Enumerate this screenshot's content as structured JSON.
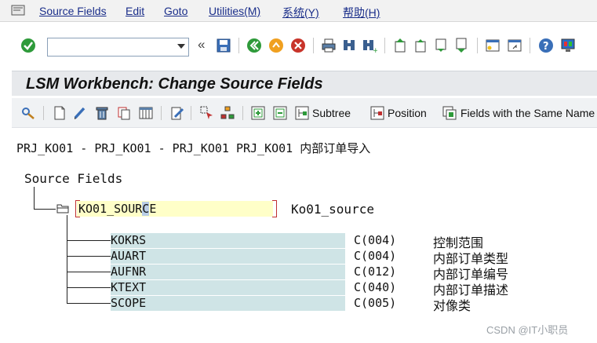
{
  "menu": {
    "items": [
      "Source Fields",
      "Edit",
      "Goto",
      "Utilities(M)",
      "系统(Y)",
      "帮助(H)"
    ]
  },
  "command_field": {
    "value": ""
  },
  "toolbar": {
    "nav_back_symbol": "«"
  },
  "title": "LSM Workbench: Change Source Fields",
  "app_toolbar": {
    "subtree_label": "Subtree",
    "position_label": "Position",
    "same_name_label": "Fields with the Same Name"
  },
  "content": {
    "headline": "PRJ_KO01 - PRJ_KO01 - PRJ_KO01 PRJ_KO01 内部订单导入",
    "root_label": "Source Fields",
    "structure": {
      "name_pre": "KO01_SOUR",
      "name_cursor": "C",
      "name_post": "E",
      "description": "Ko01_source"
    },
    "fields": [
      {
        "name": "KOKRS",
        "type": "C(004)",
        "desc": "控制范围"
      },
      {
        "name": "AUART",
        "type": "C(004)",
        "desc": "内部订单类型"
      },
      {
        "name": "AUFNR",
        "type": "C(012)",
        "desc": "内部订单编号"
      },
      {
        "name": "KTEXT",
        "type": "C(040)",
        "desc": "内部订单描述"
      },
      {
        "name": "SCOPE",
        "type": "C(005)",
        "desc": "对像类"
      }
    ]
  },
  "watermark": "CSDN @IT小职员",
  "colors": {
    "menu_text": "#1a2e8a",
    "node_highlight": "#ffffc8",
    "field_highlight": "#cfe4e6",
    "ok_green": "#2e9a3a",
    "cancel_red": "#c8342a"
  }
}
